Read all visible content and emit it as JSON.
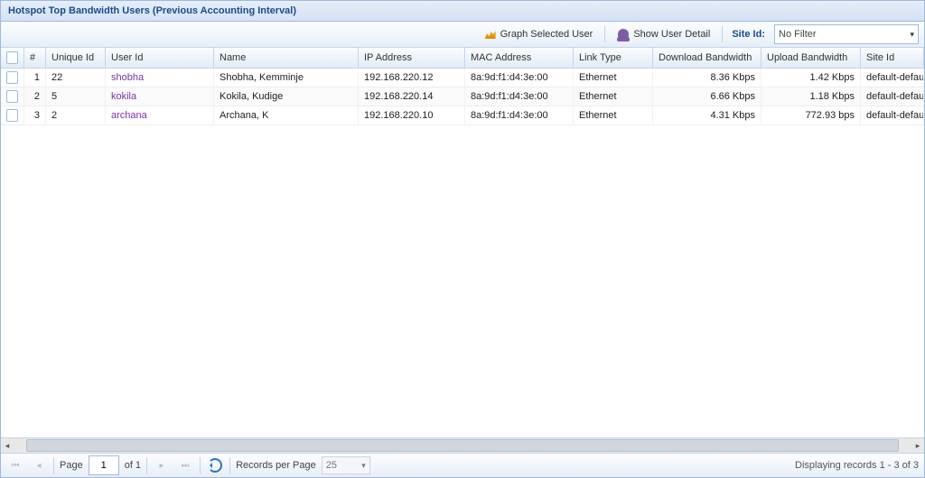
{
  "header": {
    "title": "Hotspot Top Bandwidth Users (Previous Accounting Interval)"
  },
  "toolbar": {
    "graph_label": "Graph Selected User",
    "detail_label": "Show User Detail",
    "site_label": "Site Id:",
    "site_value": "No Filter"
  },
  "columns": {
    "idx": "#",
    "unique_id": "Unique Id",
    "user_id": "User Id",
    "name": "Name",
    "ip": "IP Address",
    "mac": "MAC Address",
    "link_type": "Link Type",
    "download": "Download Bandwidth",
    "upload": "Upload Bandwidth",
    "site": "Site Id"
  },
  "rows": [
    {
      "idx": "1",
      "unique_id": "22",
      "user_id": "shobha",
      "name": "Shobha, Kemminje",
      "ip": "192.168.220.12",
      "mac": "8a:9d:f1:d4:3e:00",
      "link_type": "Ethernet",
      "download": "8.36 Kbps",
      "upload": "1.42 Kbps",
      "site": "default-default"
    },
    {
      "idx": "2",
      "unique_id": "5",
      "user_id": "kokila",
      "name": "Kokila, Kudige",
      "ip": "192.168.220.14",
      "mac": "8a:9d:f1:d4:3e:00",
      "link_type": "Ethernet",
      "download": "6.66 Kbps",
      "upload": "1.18 Kbps",
      "site": "default-default"
    },
    {
      "idx": "3",
      "unique_id": "2",
      "user_id": "archana",
      "name": "Archana, K",
      "ip": "192.168.220.10",
      "mac": "8a:9d:f1:d4:3e:00",
      "link_type": "Ethernet",
      "download": "4.31 Kbps",
      "upload": "772.93 bps",
      "site": "default-default"
    }
  ],
  "footer": {
    "page_label": "Page",
    "page_value": "1",
    "of_label": "of 1",
    "rpp_label": "Records per Page",
    "rpp_value": "25",
    "status": "Displaying records 1 - 3 of 3"
  }
}
